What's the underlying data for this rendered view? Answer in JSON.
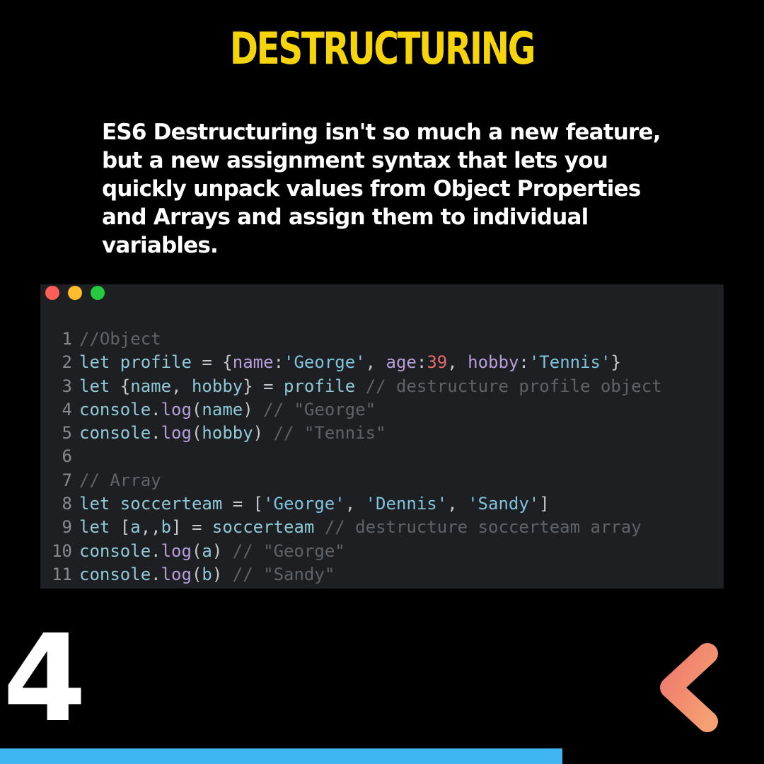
{
  "title": "DESTRUCTURING",
  "description": "ES6 Destructuring isn't so much a new feature, but a new assignment syntax that lets you quickly unpack values from Object Properties and Arrays and assign them to individual variables.",
  "window_dots": {
    "colors": [
      "#ff5f56",
      "#ffbd2e",
      "#27c93f"
    ]
  },
  "code": {
    "lines": [
      {
        "n": "1",
        "tokens": [
          {
            "t": "//Object",
            "c": "cmt"
          }
        ]
      },
      {
        "n": "2",
        "tokens": [
          {
            "t": "let",
            "c": "kw"
          },
          {
            "t": " profile ",
            "c": "var"
          },
          {
            "t": "= {",
            "c": "punc"
          },
          {
            "t": "name",
            "c": "prop"
          },
          {
            "t": ":",
            "c": "punc"
          },
          {
            "t": "'George'",
            "c": "str"
          },
          {
            "t": ", ",
            "c": "punc"
          },
          {
            "t": "age",
            "c": "prop"
          },
          {
            "t": ":",
            "c": "punc"
          },
          {
            "t": "39",
            "c": "num"
          },
          {
            "t": ", ",
            "c": "punc"
          },
          {
            "t": "hobby",
            "c": "prop"
          },
          {
            "t": ":",
            "c": "punc"
          },
          {
            "t": "'Tennis'",
            "c": "str"
          },
          {
            "t": "}",
            "c": "punc"
          }
        ]
      },
      {
        "n": "3",
        "tokens": [
          {
            "t": "let",
            "c": "kw"
          },
          {
            "t": " {",
            "c": "punc"
          },
          {
            "t": "name",
            "c": "var"
          },
          {
            "t": ", ",
            "c": "punc"
          },
          {
            "t": "hobby",
            "c": "var"
          },
          {
            "t": "} = ",
            "c": "punc"
          },
          {
            "t": "profile",
            "c": "var"
          },
          {
            "t": " // destructure profile object",
            "c": "cmt"
          }
        ]
      },
      {
        "n": "4",
        "tokens": [
          {
            "t": "console",
            "c": "var"
          },
          {
            "t": ".",
            "c": "punc"
          },
          {
            "t": "log",
            "c": "prop"
          },
          {
            "t": "(",
            "c": "punc"
          },
          {
            "t": "name",
            "c": "var"
          },
          {
            "t": ")",
            "c": "punc"
          },
          {
            "t": " // \"George\"",
            "c": "cmt"
          }
        ]
      },
      {
        "n": "5",
        "tokens": [
          {
            "t": "console",
            "c": "var"
          },
          {
            "t": ".",
            "c": "punc"
          },
          {
            "t": "log",
            "c": "prop"
          },
          {
            "t": "(",
            "c": "punc"
          },
          {
            "t": "hobby",
            "c": "var"
          },
          {
            "t": ")",
            "c": "punc"
          },
          {
            "t": " // \"Tennis\"",
            "c": "cmt"
          }
        ]
      },
      {
        "n": "6",
        "tokens": []
      },
      {
        "n": "7",
        "tokens": [
          {
            "t": "// Array",
            "c": "cmt"
          }
        ]
      },
      {
        "n": "8",
        "tokens": [
          {
            "t": "let",
            "c": "kw"
          },
          {
            "t": " soccerteam ",
            "c": "var"
          },
          {
            "t": "= [",
            "c": "punc"
          },
          {
            "t": "'George'",
            "c": "str"
          },
          {
            "t": ", ",
            "c": "punc"
          },
          {
            "t": "'Dennis'",
            "c": "str"
          },
          {
            "t": ", ",
            "c": "punc"
          },
          {
            "t": "'Sandy'",
            "c": "str"
          },
          {
            "t": "]",
            "c": "punc"
          }
        ]
      },
      {
        "n": "9",
        "tokens": [
          {
            "t": "let",
            "c": "kw"
          },
          {
            "t": " [",
            "c": "punc"
          },
          {
            "t": "a",
            "c": "var"
          },
          {
            "t": ",,",
            "c": "punc"
          },
          {
            "t": "b",
            "c": "var"
          },
          {
            "t": "] = ",
            "c": "punc"
          },
          {
            "t": "soccerteam",
            "c": "var"
          },
          {
            "t": " // destructure soccerteam array",
            "c": "cmt"
          }
        ]
      },
      {
        "n": "10",
        "tokens": [
          {
            "t": "console",
            "c": "var"
          },
          {
            "t": ".",
            "c": "punc"
          },
          {
            "t": "log",
            "c": "prop"
          },
          {
            "t": "(",
            "c": "punc"
          },
          {
            "t": "a",
            "c": "var"
          },
          {
            "t": ")",
            "c": "punc"
          },
          {
            "t": " // \"George\"",
            "c": "cmt"
          }
        ]
      },
      {
        "n": "11",
        "tokens": [
          {
            "t": "console",
            "c": "var"
          },
          {
            "t": ".",
            "c": "punc"
          },
          {
            "t": "log",
            "c": "prop"
          },
          {
            "t": "(",
            "c": "punc"
          },
          {
            "t": "b",
            "c": "var"
          },
          {
            "t": ")",
            "c": "punc"
          },
          {
            "t": " // \"Sandy\"",
            "c": "cmt"
          }
        ]
      }
    ]
  },
  "page_number": "4",
  "nav": {
    "prev_icon": "chevron-left-icon"
  },
  "colors": {
    "title": "#f5d40b",
    "progress_bar": "#3db6f2",
    "arrow_start": "#f07a6e",
    "arrow_end": "#f4a072"
  }
}
